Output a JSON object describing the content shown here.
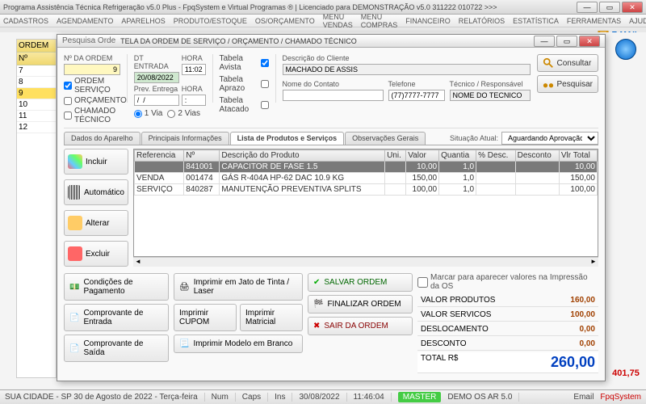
{
  "titlebar": "Programa Assistência Técnica Refrigeração v5.0 Plus - FpqSystem e Virtual Programas ® | Licenciado para  DEMONSTRAÇÃO v5.0 311222 010722 >>>",
  "menu": [
    "CADASTROS",
    "AGENDAMENTO",
    "APARELHOS",
    "PRODUTO/ESTOQUE",
    "OS/ORÇAMENTO",
    "MENU VENDAS",
    "MENU COMPRAS",
    "FINANCEIRO",
    "RELATÓRIOS",
    "ESTATÍSTICA",
    "FERRAMENTAS",
    "AJUDA"
  ],
  "email_label": "E-MAIL",
  "back": {
    "ordem": "ORDEM",
    "nums": [
      "7",
      "8",
      "9",
      "10",
      "11",
      "12"
    ],
    "rightval": "401,75"
  },
  "dialog": {
    "title": "TELA DA ORDEM DE SERVIÇO / ORÇAMENTO / CHAMADO TÉCNICO",
    "tab_label_left": "Pesquisa Orde",
    "ordem_lbl": "Nº DA ORDEM",
    "ordem_val": "9",
    "entrada_lbl": "DT ENTRADA",
    "entrada_val": "20/08/2022",
    "hora_lbl": "HORA",
    "hora_val": "11:02",
    "prev_lbl": "Prev. Entrega",
    "prev_hora_lbl": "HORA",
    "prev_date": "/  /",
    "prev_hora": ":",
    "via_lbl": "1 Via",
    "vias_lbl": "2 Vias",
    "chk_ordem": "ORDEM SERVIÇO",
    "chk_orc": "ORÇAMENTO",
    "chk_chamado": "CHAMADO TÉCNICO",
    "tab_avista": "Tabela Avista",
    "tab_aprazo": "Tabela Aprazo",
    "tab_atacado": "Tabela Atacado",
    "desc_cliente_lbl": "Descrição do Cliente",
    "desc_cliente": "MACHADO DE ASSIS",
    "contato_lbl": "Nome do Contato",
    "contato": "",
    "telefone_lbl": "Telefone",
    "telefone": "(77)7777-7777",
    "tecnico_lbl": "Técnico / Responsável",
    "tecnico": "NOME DO TECNICO",
    "btn_consultar": "Consultar",
    "btn_pesquisar": "Pesquisar",
    "tabs": [
      "Dados do Aparelho",
      "Principais Informações",
      "Lista de Produtos e Serviços",
      "Observações Gerais"
    ],
    "situ_lbl": "Situação Atual:",
    "situ_val": "Aguardando Aprovação",
    "side": {
      "incluir": "Incluir",
      "auto": "Automático",
      "alterar": "Alterar",
      "excluir": "Excluir"
    },
    "grid": {
      "cols": [
        "Referencia",
        "Nº",
        "Descrição do Produto",
        "Uni.",
        "Valor",
        "Quantia",
        "% Desc.",
        "Desconto",
        "Vlr Total"
      ],
      "rows": [
        {
          "ref": "",
          "n": "841001",
          "desc": "CAPACITOR DE FASE 1.5",
          "uni": "",
          "val": "10,00",
          "qt": "1,0",
          "pd": "",
          "d": "",
          "tot": "10,00",
          "sel": true
        },
        {
          "ref": "VENDA",
          "n": "001474",
          "desc": "GÁS R-404A HP-62 DAC 10.9 KG",
          "uni": "",
          "val": "150,00",
          "qt": "1,0",
          "pd": "",
          "d": "",
          "tot": "150,00"
        },
        {
          "ref": "SERVIÇO",
          "n": "840287",
          "desc": "MANUTENÇÃO PREVENTIVA SPLITS",
          "uni": "",
          "val": "100,00",
          "qt": "1,0",
          "pd": "",
          "d": "",
          "tot": "100,00"
        }
      ]
    },
    "bot": {
      "cond": "Condições de Pagamento",
      "comp_ent": "Comprovante de Entrada",
      "comp_sai": "Comprovante de Saída",
      "jato": "Imprimir em Jato de Tinta / Laser",
      "cupom": "Imprimir CUPOM",
      "matricial": "Imprimir Matricial",
      "branco": "Imprimir Modelo em Branco",
      "salvar": "SALVAR ORDEM",
      "finalizar": "FINALIZAR ORDEM",
      "sair": "SAIR DA ORDEM"
    },
    "totals": {
      "marcar": "Marcar para aparecer valores na Impressão da OS",
      "prod_lbl": "VALOR PRODUTOS",
      "prod": "160,00",
      "serv_lbl": "VALOR SERVICOS",
      "serv": "100,00",
      "desl_lbl": "DESLOCAMENTO",
      "desl": "0,00",
      "desc_lbl": "DESCONTO",
      "desc": "0,00",
      "tot_lbl": "TOTAL R$",
      "tot": "260,00"
    }
  },
  "status": {
    "cidade": "SUA CIDADE - SP 30 de Agosto de 2022 - Terça-feira",
    "num": "Num",
    "caps": "Caps",
    "ins": "Ins",
    "data": "30/08/2022",
    "hora": "11:46:04",
    "master": "MASTER",
    "demo": "DEMO OS AR 5.0",
    "email": "Email",
    "fpq": "FpqSystem"
  }
}
